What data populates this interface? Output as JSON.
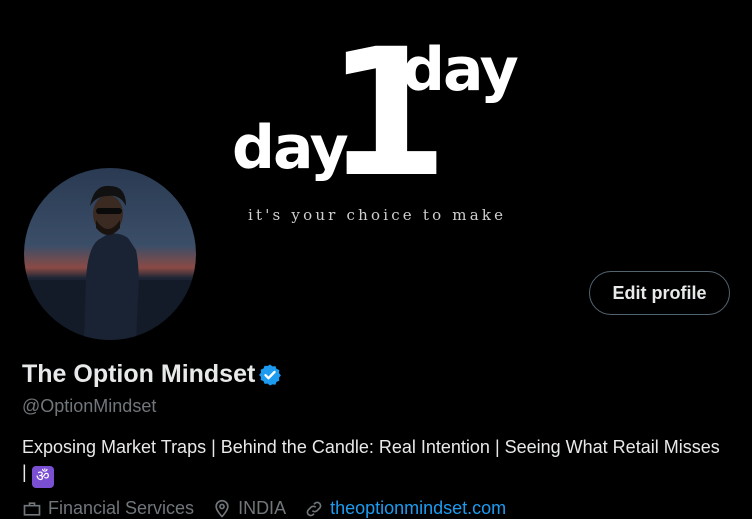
{
  "banner": {
    "word_left": "day",
    "numeral": "1",
    "word_right": "day",
    "tagline": "it's your choice to make"
  },
  "profile": {
    "edit_label": "Edit profile",
    "name": "The Option Mindset",
    "handle": "@OptionMindset",
    "bio": "Exposing Market Traps | Behind the Candle: Real Intention | Seeing What Retail Misses | ",
    "bio_emoji": "ॐ",
    "category": "Financial Services",
    "location": "INDIA",
    "website": "theoptionmindset.com"
  },
  "colors": {
    "background": "#000000",
    "text": "#e7e9ea",
    "muted": "#71767b",
    "verified": "#1d9bf0",
    "link": "#1d9bf0"
  },
  "icons": [
    "verified-badge-icon",
    "briefcase-icon",
    "location-pin-icon",
    "link-icon"
  ]
}
